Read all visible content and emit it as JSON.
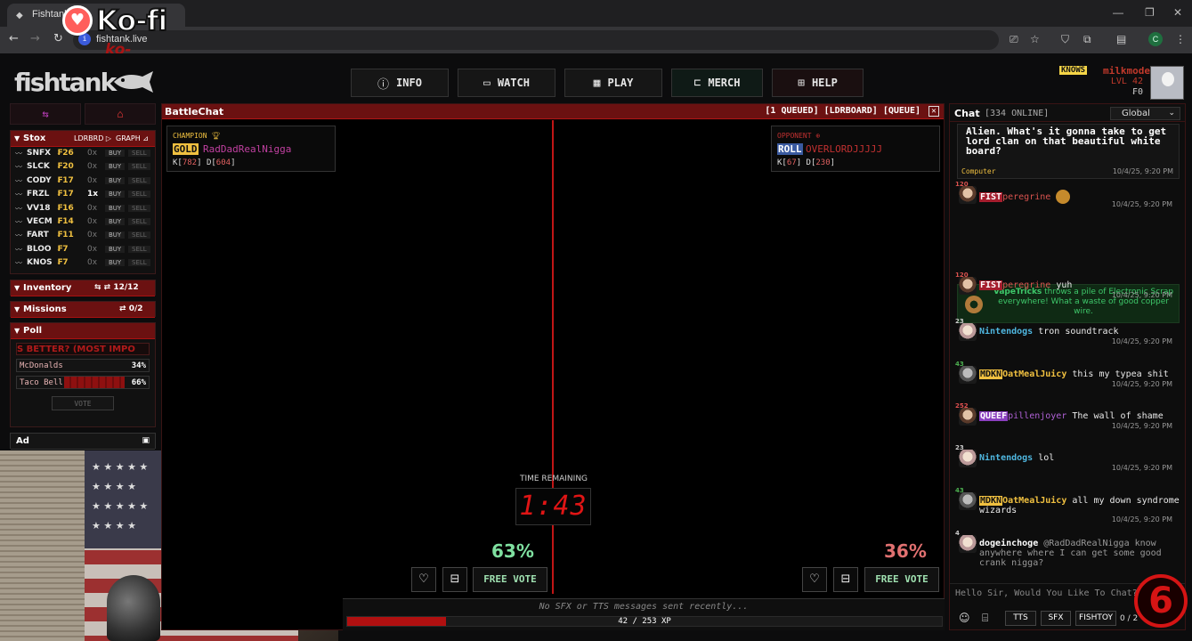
{
  "browser": {
    "tab_title": "Fishtank LI",
    "url": "fishtank.live"
  },
  "overlay": {
    "kofi_text": "Ko-fi",
    "kofi_url": "ko-fi.com/channel6",
    "watermark": "6"
  },
  "header": {
    "logo": "fishtank",
    "nav": [
      {
        "label": "INFO",
        "icon": "info-icon"
      },
      {
        "label": "WATCH",
        "icon": "camera-icon"
      },
      {
        "label": "PLAY",
        "icon": "checker-icon"
      },
      {
        "label": "MERCH",
        "icon": "cart-icon"
      },
      {
        "label": "HELP",
        "icon": "help-icon"
      }
    ],
    "user": {
      "badge": "KNOWS",
      "name": "milkmoder",
      "level": "LVL 42",
      "coins": "₣0"
    }
  },
  "stox": {
    "title": "Stox",
    "ldrbrd": "LDRBRD",
    "graph": "GRAPH",
    "rows": [
      {
        "sym": "SNFX",
        "price": "₣26",
        "owned": "0x",
        "buy": "BUY",
        "sell": "SELL"
      },
      {
        "sym": "SLCK",
        "price": "₣20",
        "owned": "0x",
        "buy": "BUY",
        "sell": "SELL"
      },
      {
        "sym": "CODY",
        "price": "₣17",
        "owned": "0x",
        "buy": "BUY",
        "sell": "SELL"
      },
      {
        "sym": "FRZL",
        "price": "₣17",
        "owned": "1x",
        "buy": "BUY",
        "sell": "SELL"
      },
      {
        "sym": "VV18",
        "price": "₣16",
        "owned": "0x",
        "buy": "BUY",
        "sell": "SELL"
      },
      {
        "sym": "VECM",
        "price": "₣14",
        "owned": "0x",
        "buy": "BUY",
        "sell": "SELL"
      },
      {
        "sym": "FART",
        "price": "₣11",
        "owned": "0x",
        "buy": "BUY",
        "sell": "SELL"
      },
      {
        "sym": "BLOO",
        "price": "₣7",
        "owned": "0x",
        "buy": "BUY",
        "sell": "SELL"
      },
      {
        "sym": "KNOS",
        "price": "₣7",
        "owned": "0x",
        "buy": "BUY",
        "sell": "SELL"
      }
    ]
  },
  "inventory": {
    "title": "Inventory",
    "count": "12/12"
  },
  "missions": {
    "title": "Missions",
    "count": "0/2"
  },
  "poll": {
    "title": "Poll",
    "question": "S BETTER? (MOST IMPO",
    "options": [
      {
        "label": "McDonalds",
        "pct": "34%",
        "fraction": 0.34
      },
      {
        "label": "Taco Bell",
        "pct": "66%",
        "fraction": 0.66
      }
    ],
    "vote": "VOTE"
  },
  "ad": {
    "title": "Ad"
  },
  "battle": {
    "title": "BattleChat",
    "links": "[1 QUEUED] [LDRBOARD] [QUEUE]",
    "champion": {
      "role": "CHAMPION",
      "badge": "GOLD",
      "name": "RadDadRealNigga",
      "k": "782",
      "d": "604"
    },
    "opponent": {
      "role": "OPPONENT",
      "badge": "ROLL",
      "name": "OVERLORDJJJJJ",
      "k": "67",
      "d": "230"
    },
    "timer_label": "TIME REMAINING",
    "timer": "1:43",
    "left_pct": "63%",
    "right_pct": "36%",
    "free_vote": "FREE VOTE",
    "sfx_note": "No SFX or TTS messages sent recently...",
    "xp_text": "42 / 253 XP",
    "xp_fraction": 0.166
  },
  "chat": {
    "title": "Chat",
    "online": "[334 ONLINE]",
    "channel": "Global",
    "system": {
      "text": "Alien. What's it gonna take to get lord clan on that beautiful white board?",
      "author": "Computer",
      "time": "10/4/25, 9:20 PM"
    },
    "event": {
      "user": "VapeTricks",
      "text": " throws a pile of Electronic Scrap everywhere! What a waste of good copper wire."
    },
    "messages": [
      {
        "lvl": "120",
        "badge": "FIST",
        "user": "peregrine",
        "text": "",
        "time": "10/4/25, 9:20 PM"
      },
      {
        "lvl": "120",
        "badge": "FIST",
        "user": "peregrine",
        "text": "yuh",
        "time": "10/4/25, 9:20 PM"
      },
      {
        "lvl": "23",
        "badge": "",
        "user": "Nintendogs",
        "text": "tron soundtrack",
        "time": "10/4/25, 9:20 PM"
      },
      {
        "lvl": "43",
        "badge": "MDKN",
        "user": "OatMealJuicy",
        "text": "this my typea shit",
        "time": "10/4/25, 9:20 PM"
      },
      {
        "lvl": "252",
        "badge": "QUEEF",
        "user": "pillenjoyer",
        "text": "The wall of shame",
        "time": "10/4/25, 9:20 PM"
      },
      {
        "lvl": "23",
        "badge": "",
        "user": "Nintendogs",
        "text": "lol",
        "time": "10/4/25, 9:20 PM"
      },
      {
        "lvl": "43",
        "badge": "MDKN",
        "user": "OatMealJuicy",
        "text": "all my down syndrome wizards",
        "time": "10/4/25, 9:20 PM"
      },
      {
        "lvl": "4",
        "badge": "",
        "user": "dogeinchoge",
        "text": "@RadDadRealNigga know anywhere where I can get some good crank nigga?",
        "time": ""
      }
    ],
    "input_placeholder": "Hello Sir, Would You Like To Chat?",
    "tools": {
      "tts": "TTS",
      "sfx": "SFX",
      "fishtoy": "FISHTOY",
      "count": "0 / 2"
    }
  }
}
